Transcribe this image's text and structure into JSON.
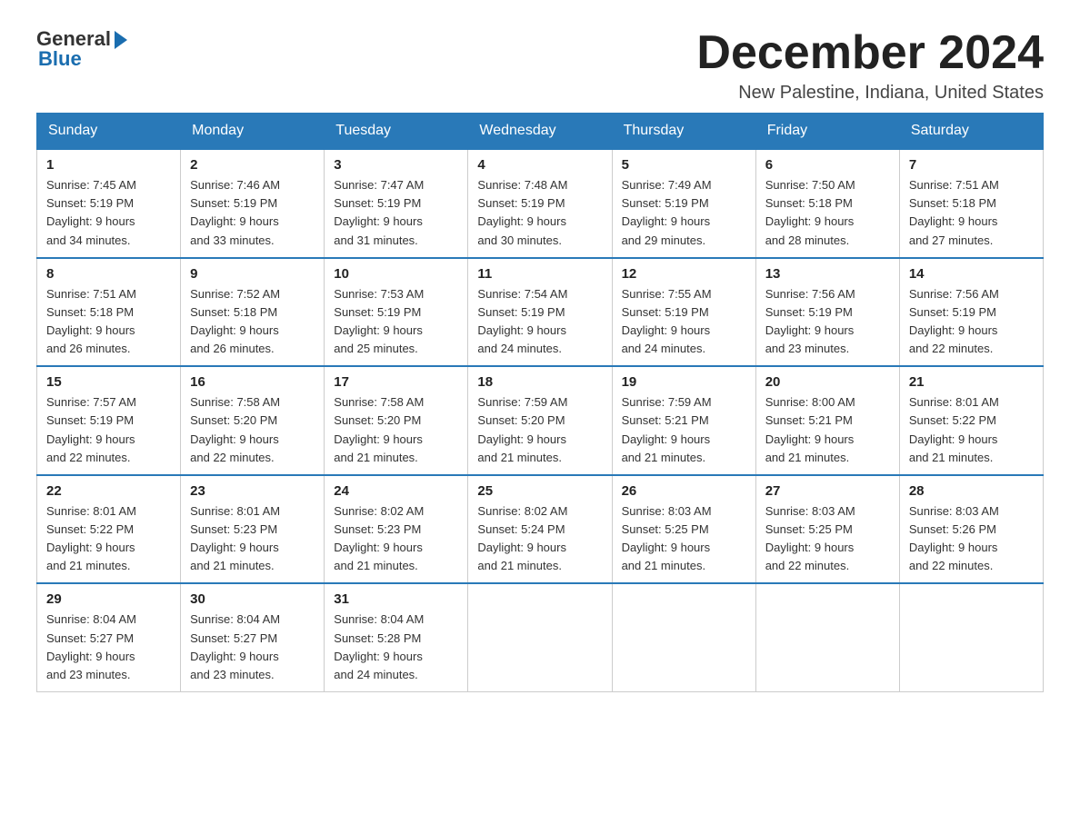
{
  "header": {
    "logo_general": "General",
    "logo_blue": "Blue",
    "title": "December 2024",
    "location": "New Palestine, Indiana, United States"
  },
  "days_of_week": [
    "Sunday",
    "Monday",
    "Tuesday",
    "Wednesday",
    "Thursday",
    "Friday",
    "Saturday"
  ],
  "weeks": [
    [
      {
        "day": "1",
        "sunrise": "7:45 AM",
        "sunset": "5:19 PM",
        "daylight": "9 hours and 34 minutes."
      },
      {
        "day": "2",
        "sunrise": "7:46 AM",
        "sunset": "5:19 PM",
        "daylight": "9 hours and 33 minutes."
      },
      {
        "day": "3",
        "sunrise": "7:47 AM",
        "sunset": "5:19 PM",
        "daylight": "9 hours and 31 minutes."
      },
      {
        "day": "4",
        "sunrise": "7:48 AM",
        "sunset": "5:19 PM",
        "daylight": "9 hours and 30 minutes."
      },
      {
        "day": "5",
        "sunrise": "7:49 AM",
        "sunset": "5:19 PM",
        "daylight": "9 hours and 29 minutes."
      },
      {
        "day": "6",
        "sunrise": "7:50 AM",
        "sunset": "5:18 PM",
        "daylight": "9 hours and 28 minutes."
      },
      {
        "day": "7",
        "sunrise": "7:51 AM",
        "sunset": "5:18 PM",
        "daylight": "9 hours and 27 minutes."
      }
    ],
    [
      {
        "day": "8",
        "sunrise": "7:51 AM",
        "sunset": "5:18 PM",
        "daylight": "9 hours and 26 minutes."
      },
      {
        "day": "9",
        "sunrise": "7:52 AM",
        "sunset": "5:18 PM",
        "daylight": "9 hours and 26 minutes."
      },
      {
        "day": "10",
        "sunrise": "7:53 AM",
        "sunset": "5:19 PM",
        "daylight": "9 hours and 25 minutes."
      },
      {
        "day": "11",
        "sunrise": "7:54 AM",
        "sunset": "5:19 PM",
        "daylight": "9 hours and 24 minutes."
      },
      {
        "day": "12",
        "sunrise": "7:55 AM",
        "sunset": "5:19 PM",
        "daylight": "9 hours and 24 minutes."
      },
      {
        "day": "13",
        "sunrise": "7:56 AM",
        "sunset": "5:19 PM",
        "daylight": "9 hours and 23 minutes."
      },
      {
        "day": "14",
        "sunrise": "7:56 AM",
        "sunset": "5:19 PM",
        "daylight": "9 hours and 22 minutes."
      }
    ],
    [
      {
        "day": "15",
        "sunrise": "7:57 AM",
        "sunset": "5:19 PM",
        "daylight": "9 hours and 22 minutes."
      },
      {
        "day": "16",
        "sunrise": "7:58 AM",
        "sunset": "5:20 PM",
        "daylight": "9 hours and 22 minutes."
      },
      {
        "day": "17",
        "sunrise": "7:58 AM",
        "sunset": "5:20 PM",
        "daylight": "9 hours and 21 minutes."
      },
      {
        "day": "18",
        "sunrise": "7:59 AM",
        "sunset": "5:20 PM",
        "daylight": "9 hours and 21 minutes."
      },
      {
        "day": "19",
        "sunrise": "7:59 AM",
        "sunset": "5:21 PM",
        "daylight": "9 hours and 21 minutes."
      },
      {
        "day": "20",
        "sunrise": "8:00 AM",
        "sunset": "5:21 PM",
        "daylight": "9 hours and 21 minutes."
      },
      {
        "day": "21",
        "sunrise": "8:01 AM",
        "sunset": "5:22 PM",
        "daylight": "9 hours and 21 minutes."
      }
    ],
    [
      {
        "day": "22",
        "sunrise": "8:01 AM",
        "sunset": "5:22 PM",
        "daylight": "9 hours and 21 minutes."
      },
      {
        "day": "23",
        "sunrise": "8:01 AM",
        "sunset": "5:23 PM",
        "daylight": "9 hours and 21 minutes."
      },
      {
        "day": "24",
        "sunrise": "8:02 AM",
        "sunset": "5:23 PM",
        "daylight": "9 hours and 21 minutes."
      },
      {
        "day": "25",
        "sunrise": "8:02 AM",
        "sunset": "5:24 PM",
        "daylight": "9 hours and 21 minutes."
      },
      {
        "day": "26",
        "sunrise": "8:03 AM",
        "sunset": "5:25 PM",
        "daylight": "9 hours and 21 minutes."
      },
      {
        "day": "27",
        "sunrise": "8:03 AM",
        "sunset": "5:25 PM",
        "daylight": "9 hours and 22 minutes."
      },
      {
        "day": "28",
        "sunrise": "8:03 AM",
        "sunset": "5:26 PM",
        "daylight": "9 hours and 22 minutes."
      }
    ],
    [
      {
        "day": "29",
        "sunrise": "8:04 AM",
        "sunset": "5:27 PM",
        "daylight": "9 hours and 23 minutes."
      },
      {
        "day": "30",
        "sunrise": "8:04 AM",
        "sunset": "5:27 PM",
        "daylight": "9 hours and 23 minutes."
      },
      {
        "day": "31",
        "sunrise": "8:04 AM",
        "sunset": "5:28 PM",
        "daylight": "9 hours and 24 minutes."
      },
      null,
      null,
      null,
      null
    ]
  ],
  "labels": {
    "sunrise": "Sunrise:",
    "sunset": "Sunset:",
    "daylight": "Daylight:"
  }
}
